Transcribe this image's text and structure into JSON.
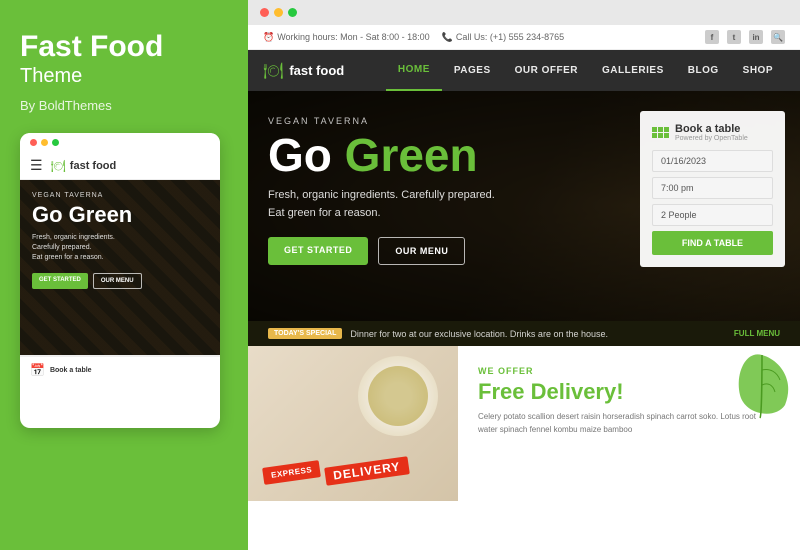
{
  "left_panel": {
    "brand_title": "Fast Food",
    "brand_subtitle": "Theme",
    "by_text": "By BoldThemes"
  },
  "mobile_mockup": {
    "vegan_label": "VEGAN TAVERNA",
    "go_green": "Go Green",
    "hero_sub_line1": "Fresh, organic ingredients.",
    "hero_sub_line2": "Carefully prepared.",
    "hero_sub_line3": "Eat green for a reason.",
    "btn_get_started": "GET STARTED",
    "btn_our_menu": "OUR MENU",
    "logo_text": "fast food",
    "book_a_table": "Book a table"
  },
  "desktop": {
    "top_bar": {
      "working_hours": "Working hours: Mon - Sat 8:00 - 18:00",
      "call_us": "Call Us: (+1) 555 234-8765",
      "social_icons": [
        "f",
        "t",
        "in",
        "🔍"
      ]
    },
    "nav": {
      "logo_text": "fast food",
      "items": [
        "HOME",
        "PAGES",
        "OUR OFFER",
        "GALLERIES",
        "BLOG",
        "SHOP"
      ]
    },
    "hero": {
      "vegan_label": "VEGAN TAVERNA",
      "title_go": "Go",
      "title_green": "Green",
      "sub_line1": "Fresh, organic ingredients. Carefully prepared.",
      "sub_line2": "Eat green for a reason.",
      "btn_get_started": "GET STARTED",
      "btn_our_menu": "OUR MENU"
    },
    "book_table": {
      "title": "Book a table",
      "powered": "Powered by OpenTable",
      "date_value": "01/16/2023",
      "time_value": "7:00 pm",
      "party_value": "2 People",
      "btn_find": "Find a table"
    },
    "todays_special": {
      "badge": "TODAY'S SPECIAL",
      "text": "Dinner for two at our exclusive location. Drinks are on the house.",
      "full_menu": "FULL MENU"
    },
    "delivery_section": {
      "express_label": "EXPRESS",
      "delivery_label": "DELIVERY",
      "we_offer": "WE OFFER",
      "title_free": "Free",
      "title_delivery": "Delivery!",
      "description": "Celery potato scallion desert raisin horseradish spinach carrot soko. Lotus root water spinach fennel kombu maize bamboo"
    }
  },
  "colors": {
    "green": "#6abf3a",
    "dark": "#2d2d2d",
    "red": "#e63018",
    "yellow": "#e8b84b"
  }
}
